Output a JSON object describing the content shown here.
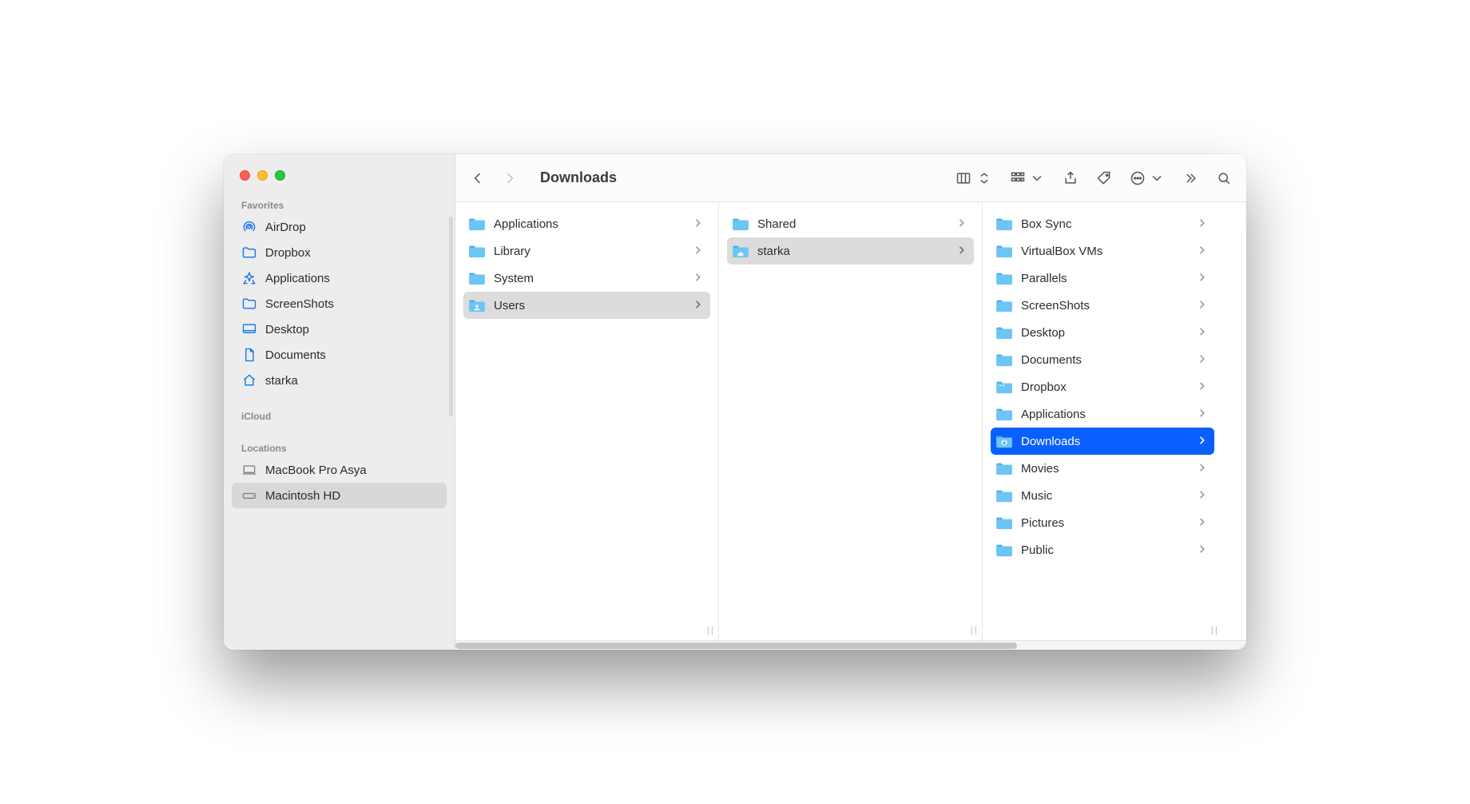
{
  "window_title": "Downloads",
  "sidebar": {
    "sections": [
      {
        "header": "Favorites",
        "items": [
          {
            "label": "AirDrop",
            "icon": "airdrop"
          },
          {
            "label": "Dropbox",
            "icon": "folder-outline"
          },
          {
            "label": "Applications",
            "icon": "appstore"
          },
          {
            "label": "ScreenShots",
            "icon": "folder-outline"
          },
          {
            "label": "Desktop",
            "icon": "desktop"
          },
          {
            "label": "Documents",
            "icon": "document"
          },
          {
            "label": "starka",
            "icon": "home"
          }
        ]
      },
      {
        "header": "iCloud",
        "items": []
      },
      {
        "header": "Locations",
        "items": [
          {
            "label": "MacBook Pro Asya",
            "icon": "laptop",
            "grey": true
          },
          {
            "label": "Macintosh HD",
            "icon": "disk",
            "grey": true,
            "selected": true
          }
        ]
      }
    ]
  },
  "columns": [
    {
      "items": [
        {
          "label": "Applications",
          "icon": "folder"
        },
        {
          "label": "Library",
          "icon": "folder"
        },
        {
          "label": "System",
          "icon": "folder"
        },
        {
          "label": "Users",
          "icon": "folder-users",
          "state": "sel"
        }
      ]
    },
    {
      "items": [
        {
          "label": "Shared",
          "icon": "folder"
        },
        {
          "label": "starka",
          "icon": "folder-home",
          "state": "sel"
        }
      ]
    },
    {
      "items": [
        {
          "label": "Box Sync",
          "icon": "folder"
        },
        {
          "label": "VirtualBox VMs",
          "icon": "folder"
        },
        {
          "label": "Parallels",
          "icon": "folder"
        },
        {
          "label": "ScreenShots",
          "icon": "folder"
        },
        {
          "label": "Desktop",
          "icon": "folder"
        },
        {
          "label": "Documents",
          "icon": "folder"
        },
        {
          "label": "Dropbox",
          "icon": "folder-dropbox"
        },
        {
          "label": "Applications",
          "icon": "folder"
        },
        {
          "label": "Downloads",
          "icon": "folder-downloads",
          "state": "focused"
        },
        {
          "label": "Movies",
          "icon": "folder"
        },
        {
          "label": "Music",
          "icon": "folder"
        },
        {
          "label": "Pictures",
          "icon": "folder"
        },
        {
          "label": "Public",
          "icon": "folder"
        }
      ]
    }
  ]
}
